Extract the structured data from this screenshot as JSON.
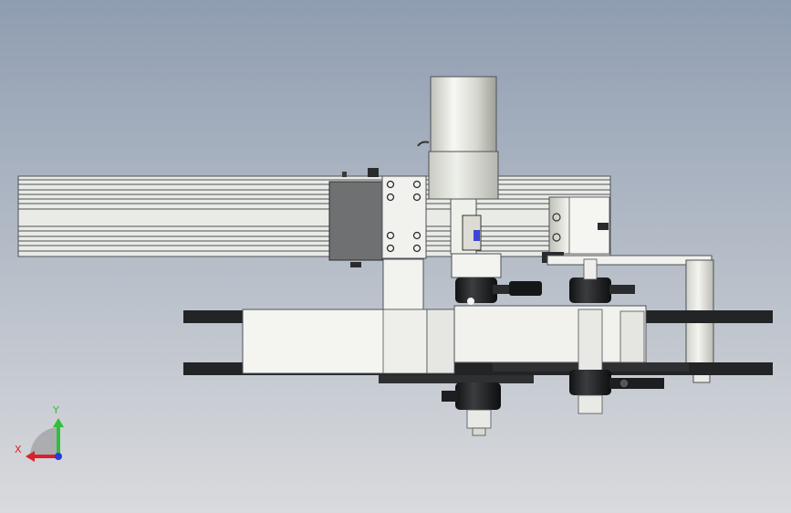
{
  "viewport": {
    "background_top": "#8f9db1",
    "background_mid": "#b9c0ca",
    "background_bottom": "#d9dadd"
  },
  "colors": {
    "profile": "#e9ebe7",
    "profile_line": "#4e5156",
    "part_light": "#f1f2ee",
    "part_dark": "#222426",
    "gray_box": "#6f7072",
    "motor_body": "#e2e3dc",
    "accent_blue": "#3b46d6",
    "axis_x": "#d8222a",
    "axis_y": "#2fbf3a",
    "axis_z": "#2a3bd8"
  },
  "triad": {
    "x_label": "X",
    "y_label": "Y",
    "x_icon": "x-axis-arrow-icon",
    "y_icon": "y-axis-arrow-icon",
    "z_icon": "z-axis-dot-icon"
  }
}
